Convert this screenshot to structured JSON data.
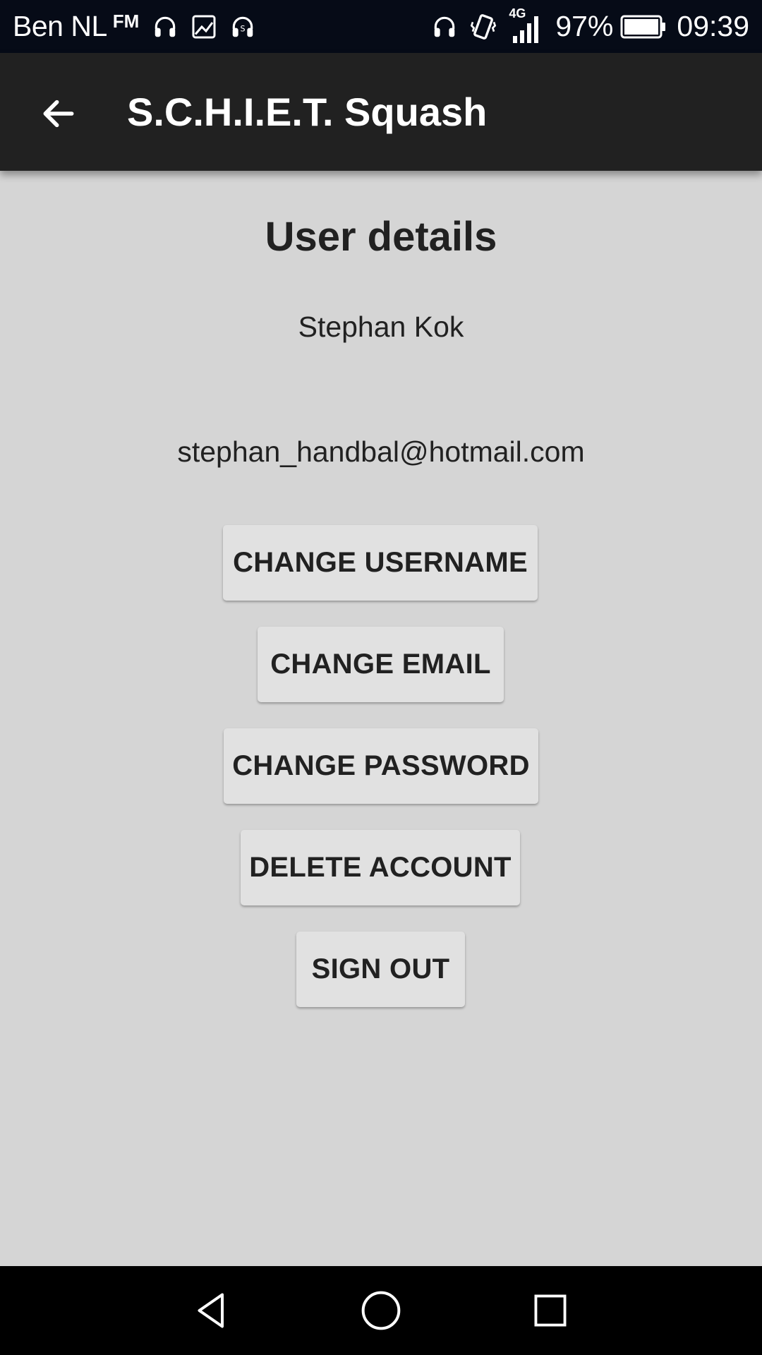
{
  "status_bar": {
    "carrier": "Ben NL",
    "fm_label": "FM",
    "network_type": "4G",
    "battery_percent": "97%",
    "time": "09:39",
    "icons": [
      "headphones-icon",
      "image-icon",
      "shazam-icon",
      "headphones-icon",
      "vibrate-icon",
      "signal-icon",
      "battery-icon"
    ]
  },
  "app_bar": {
    "back_icon": "arrow-back-icon",
    "title": "S.C.H.I.E.T. Squash"
  },
  "main": {
    "heading": "User details",
    "user_name": "Stephan Kok",
    "user_email": "stephan_handbal@hotmail.com",
    "buttons": {
      "change_username": "CHANGE USERNAME",
      "change_email": "CHANGE EMAIL",
      "change_password": "CHANGE PASSWORD",
      "delete_account": "DELETE ACCOUNT",
      "sign_out": "SIGN OUT"
    }
  },
  "nav_bar": {
    "icons": [
      "nav-back-icon",
      "nav-home-icon",
      "nav-recents-icon"
    ]
  },
  "colors": {
    "status_bar_bg": "#060b17",
    "app_bar_bg": "#212121",
    "content_bg": "#d5d5d5",
    "button_bg": "#e1e1e1",
    "text": "#212121"
  }
}
